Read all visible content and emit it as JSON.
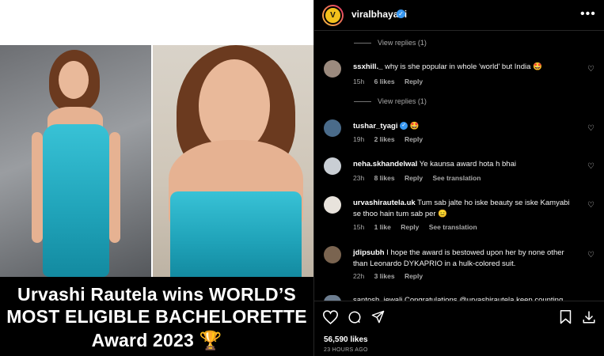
{
  "post": {
    "username": "viralbhayani",
    "avatar_letter": "V",
    "caption_lines": [
      "Urvashi Rautela wins WORLD’S",
      "MOST ELIGIBLE BACHELORETTE",
      "Award 2023 🏆"
    ]
  },
  "view_replies": [
    "View replies (1)",
    "View replies (1)"
  ],
  "comments": [
    {
      "user": "ssxhill._",
      "text": "why is she popular in whole 'world' but India 🤩",
      "time": "15h",
      "likes": "6 likes",
      "reply": "Reply",
      "translate": ""
    },
    {
      "user": "tushar_tyagi",
      "text": "🤩",
      "time": "19h",
      "likes": "2 likes",
      "reply": "Reply",
      "translate": ""
    },
    {
      "user": "neha.skhandelwal",
      "text": "Ye kaunsa award hota h bhai",
      "time": "23h",
      "likes": "8 likes",
      "reply": "Reply",
      "translate": "See translation"
    },
    {
      "user": "urvashirautela.uk",
      "text": "Tum sab jalte ho iske beauty se iske Kamyabi se thoo hain tum sab per 😑",
      "time": "15h",
      "likes": "1 like",
      "reply": "Reply",
      "translate": "See translation"
    },
    {
      "user": "jdipsubh",
      "text": "I hope the award is bestowed upon her by none other than Leonardo DYKAPRIO in a hulk-colored suit.",
      "time": "22h",
      "likes": "3 likes",
      "reply": "Reply",
      "translate": ""
    }
  ],
  "cut_comment": "santosh_jewali Congratulations @urvashirautela keep counting",
  "footer": {
    "likes": "56,590 likes",
    "time_ago": "23 HOURS AGO"
  },
  "icons": {
    "verified": "verified-badge-icon",
    "more": "more-options-icon",
    "heart": "heart-icon",
    "comment": "comment-icon",
    "share": "share-icon",
    "save": "bookmark-icon",
    "download": "download-icon",
    "next": "chevron-right-icon"
  },
  "colors": {
    "accent": "#3897f0",
    "muted": "#a8a8a8",
    "background": "#000000"
  }
}
